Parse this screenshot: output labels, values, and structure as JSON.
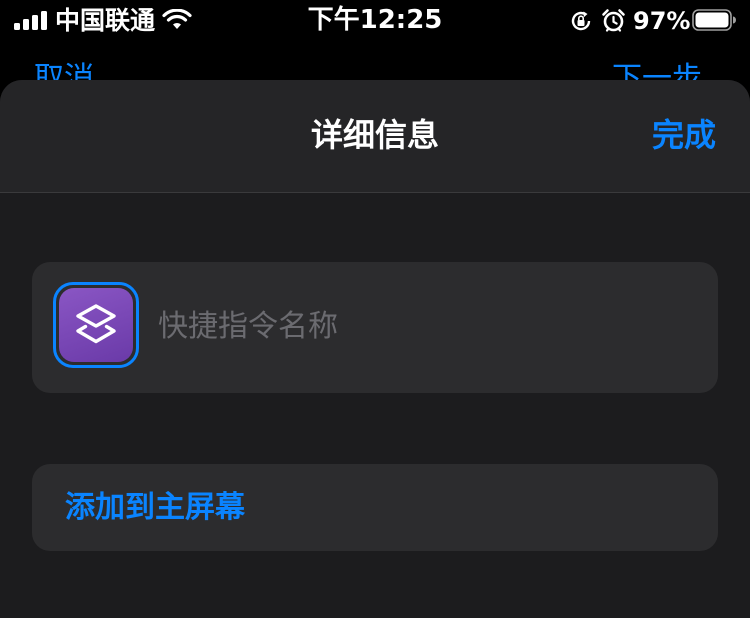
{
  "status_bar": {
    "carrier": "中国联通",
    "time": "下午12:25",
    "battery_percent": "97%",
    "icons": [
      "signal-icon",
      "wifi-icon",
      "orientation-lock-icon",
      "alarm-icon",
      "battery-icon"
    ]
  },
  "background": {
    "left_button": "取消",
    "right_button": "下一步"
  },
  "sheet": {
    "title": "详细信息",
    "done_label": "完成",
    "shortcut_icon": "shortcuts-layers-icon",
    "name_placeholder": "快捷指令名称",
    "name_value": "",
    "add_to_home_label": "添加到主屏幕"
  },
  "colors": {
    "accent": "#0a84ff",
    "sheet_background": "#1c1c1e",
    "card_background": "#2c2c2e",
    "icon_tile": "#7a4bb8"
  }
}
